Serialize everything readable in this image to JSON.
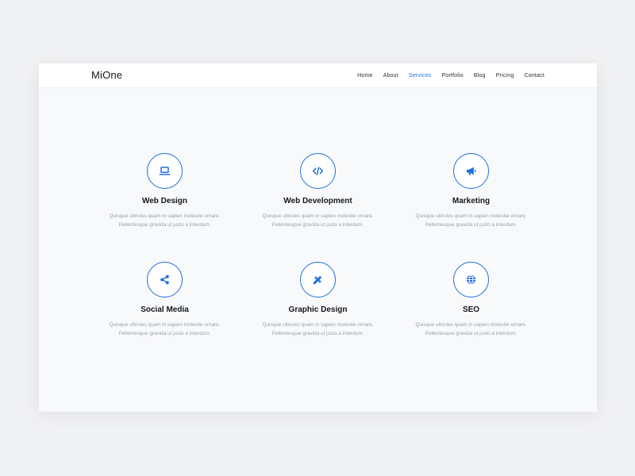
{
  "brand": "MiOne",
  "nav": {
    "items": [
      {
        "label": "Home",
        "active": false
      },
      {
        "label": "About",
        "active": false
      },
      {
        "label": "Services",
        "active": true
      },
      {
        "label": "Portfolio",
        "active": false
      },
      {
        "label": "Blog",
        "active": false
      },
      {
        "label": "Pricing",
        "active": false
      },
      {
        "label": "Contact",
        "active": false
      }
    ]
  },
  "colors": {
    "accent": "#1f6fdc",
    "title": "#15171a",
    "text_muted": "#9aa1ab",
    "panel_bg": "#f8f9fb",
    "page_bg": "#f0f1f3"
  },
  "services": [
    {
      "icon": "laptop-icon",
      "title": "Web Design",
      "line1": "Quisque ultricies quam in sapien molestie ornare.",
      "line2": "Pellentesque gravida ut justo a interdum."
    },
    {
      "icon": "code-icon",
      "title": "Web Development",
      "line1": "Quisque ultricies quam in sapien molestie ornare.",
      "line2": "Pellentesque gravida ut justo a interdum."
    },
    {
      "icon": "megaphone-icon",
      "title": "Marketing",
      "line1": "Quisque ultricies quam in sapien molestie ornare.",
      "line2": "Pellentesque gravida ut justo a interdum."
    },
    {
      "icon": "share-icon",
      "title": "Social Media",
      "line1": "Quisque ultricies quam in sapien molestie ornare.",
      "line2": "Pellentesque gravida ut justo a interdum."
    },
    {
      "icon": "pencil-ruler-icon",
      "title": "Graphic Design",
      "line1": "Quisque ultricies quam in sapien molestie ornare.",
      "line2": "Pellentesque gravida ut justo a interdum."
    },
    {
      "icon": "globe-icon",
      "title": "SEO",
      "line1": "Quisque ultricies quam in sapien molestie ornare.",
      "line2": "Pellentesque gravida ut justo a interdum."
    }
  ]
}
